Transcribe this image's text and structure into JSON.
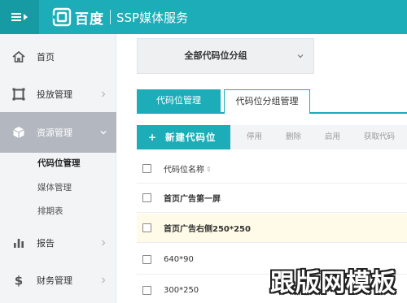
{
  "topbar": {
    "brand_name": "百度",
    "brand_sub": "SSP媒体服务",
    "accent_color": "#1cadb8",
    "menu_icon": "menu-toggle-icon"
  },
  "sidebar": {
    "items": [
      {
        "label": "首页",
        "icon": "home-icon"
      },
      {
        "label": "投放管理",
        "icon": "frame-icon"
      },
      {
        "label": "资源管理",
        "icon": "cube-icon",
        "active": true
      },
      {
        "label": "报告",
        "icon": "bar-chart-icon"
      },
      {
        "label": "财务管理",
        "icon": "dollar-icon"
      }
    ],
    "sub_items": [
      {
        "label": "代码位管理",
        "current": true
      },
      {
        "label": "媒体管理"
      },
      {
        "label": "排期表"
      }
    ]
  },
  "filter": {
    "selected": "全部代码位分组"
  },
  "tabs": [
    {
      "label": "代码位管理",
      "active": true
    },
    {
      "label": "代码位分组管理",
      "active": false
    }
  ],
  "toolbar": {
    "new_label": "新建代码位",
    "new_icon": "+",
    "actions": [
      "停用",
      "删除",
      "启用",
      "获取代码"
    ]
  },
  "table": {
    "header": "代码位名称",
    "sort_icon": "⇕",
    "rows": [
      {
        "name": "首页广告第一屏"
      },
      {
        "name": "首页广告右侧250*250",
        "highlight": true
      },
      {
        "name": "640*90"
      },
      {
        "name": "300*250"
      }
    ]
  },
  "watermark": "跟版网模板"
}
